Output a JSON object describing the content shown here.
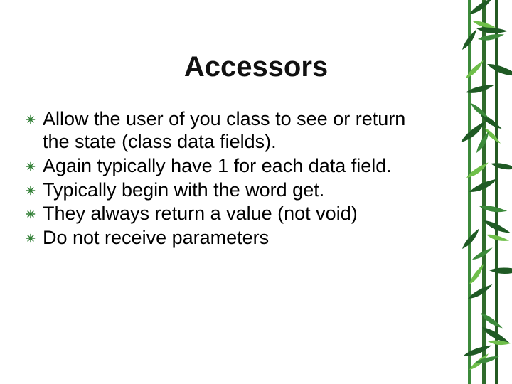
{
  "title": "Accessors",
  "bullets": [
    "Allow the user of you class to see or return the state (class data fields).",
    "Again typically have 1 for each data field.",
    "Typically begin with the word get.",
    "They always return a value (not void)",
    "Do not receive parameters"
  ],
  "theme": {
    "bullet_color": "#2e7d32",
    "bamboo_dark": "#1f5a24",
    "bamboo_mid": "#3c8a3b",
    "bamboo_light": "#6fbf4a"
  }
}
